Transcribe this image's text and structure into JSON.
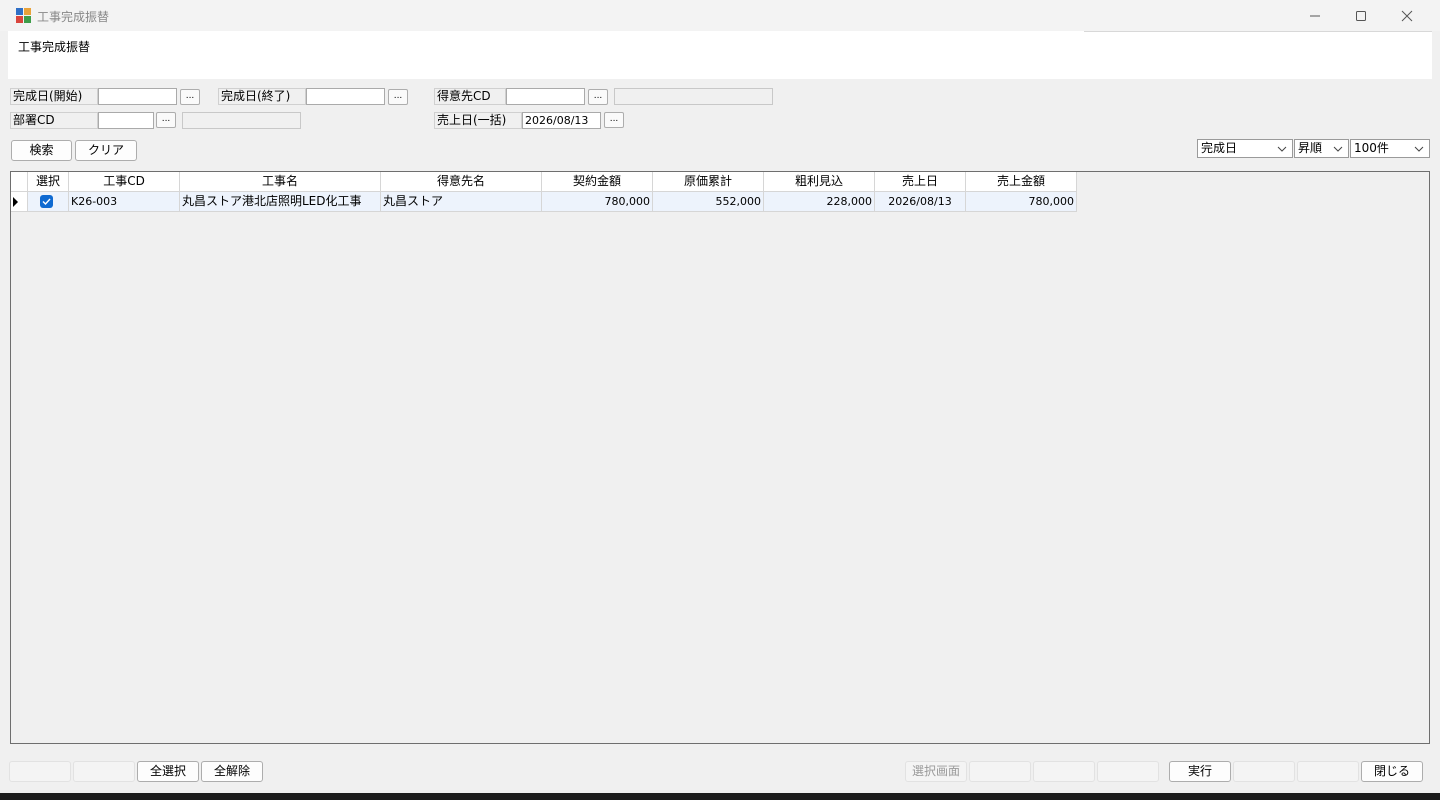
{
  "window": {
    "title": "工事完成振替"
  },
  "header": {
    "title": "工事完成振替"
  },
  "filters": {
    "completion_start": {
      "label": "完成日(開始)",
      "value": ""
    },
    "completion_end": {
      "label": "完成日(終了)",
      "value": ""
    },
    "customer_cd": {
      "label": "得意先CD",
      "value": "",
      "name": ""
    },
    "dept_cd": {
      "label": "部署CD",
      "value": "",
      "name": ""
    },
    "sales_date": {
      "label": "売上日(一括)",
      "value": "2026/08/13"
    },
    "browse_label": "..."
  },
  "actions": {
    "search": "検索",
    "clear": "クリア"
  },
  "sort": {
    "field": "完成日",
    "order": "昇順",
    "limit": "100件"
  },
  "grid": {
    "columns": [
      "選択",
      "工事CD",
      "工事名",
      "得意先名",
      "契約金額",
      "原価累計",
      "粗利見込",
      "売上日",
      "売上金額"
    ],
    "rows": [
      {
        "selected": true,
        "cd": "K26-003",
        "name": "丸昌ストア港北店照明LED化工事",
        "customer": "丸昌ストア",
        "contract": "780,000",
        "cost": "552,000",
        "margin": "228,000",
        "sales_date": "2026/08/13",
        "sales_amount": "780,000"
      }
    ]
  },
  "footer": {
    "select_all": "全選択",
    "deselect_all": "全解除",
    "select_screen": "選択画面",
    "execute": "実行",
    "close": "閉じる"
  },
  "icons": {
    "app": "app-icon",
    "minimize": "minimize-icon",
    "maximize": "maximize-icon",
    "close": "close-icon",
    "dropdown": "chevron-down-icon",
    "checkbox": "checkbox-checked-icon",
    "row_marker": "row-pointer-icon"
  },
  "colors": {
    "accent": "#0f6ad1",
    "row_bg": "#edf3fc",
    "window_bg": "#f0f0f0"
  }
}
